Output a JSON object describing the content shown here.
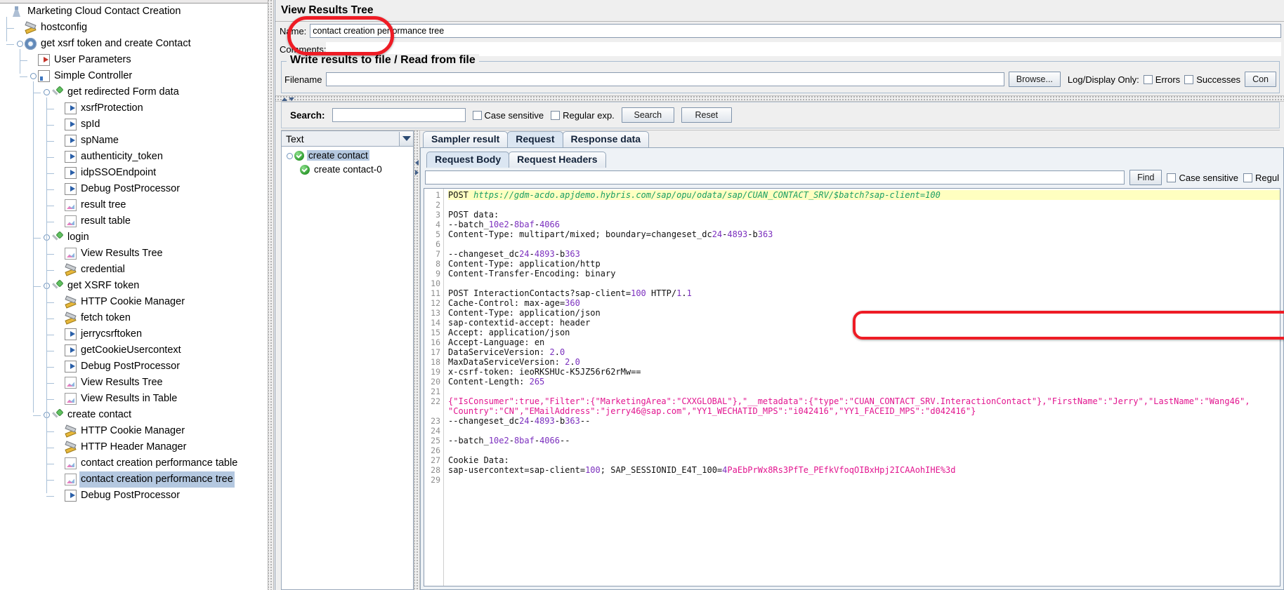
{
  "test_plan": {
    "nodes": [
      {
        "label": "Marketing Cloud Contact Creation",
        "depth": 0,
        "icon": "test-plan-icon",
        "handle": false
      },
      {
        "label": "hostconfig",
        "depth": 1,
        "icon": "config-tools-icon",
        "handle": false
      },
      {
        "label": "get xsrf token and create Contact",
        "depth": 1,
        "icon": "thread-group-gear-icon",
        "handle": true
      },
      {
        "label": "User Parameters",
        "depth": 2,
        "icon": "user-parameters-icon",
        "handle": false
      },
      {
        "label": "Simple Controller",
        "depth": 2,
        "icon": "simple-controller-icon",
        "handle": true
      },
      {
        "label": "get redirected Form data",
        "depth": 3,
        "icon": "http-sampler-icon",
        "handle": true
      },
      {
        "label": "xsrfProtection",
        "depth": 4,
        "icon": "post-processor-icon",
        "handle": false
      },
      {
        "label": "spId",
        "depth": 4,
        "icon": "post-processor-icon",
        "handle": false
      },
      {
        "label": "spName",
        "depth": 4,
        "icon": "post-processor-icon",
        "handle": false
      },
      {
        "label": "authenticity_token",
        "depth": 4,
        "icon": "post-processor-icon",
        "handle": false
      },
      {
        "label": "idpSSOEndpoint",
        "depth": 4,
        "icon": "post-processor-icon",
        "handle": false
      },
      {
        "label": "Debug PostProcessor",
        "depth": 4,
        "icon": "post-processor-icon",
        "handle": false
      },
      {
        "label": "result tree",
        "depth": 4,
        "icon": "listener-chart-icon",
        "handle": false
      },
      {
        "label": "result table",
        "depth": 4,
        "icon": "listener-chart-icon",
        "handle": false
      },
      {
        "label": "login",
        "depth": 3,
        "icon": "http-sampler-icon",
        "handle": true
      },
      {
        "label": "View Results Tree",
        "depth": 4,
        "icon": "listener-chart-icon",
        "handle": false
      },
      {
        "label": "credential",
        "depth": 4,
        "icon": "config-tools-icon",
        "handle": false
      },
      {
        "label": "get XSRF token",
        "depth": 3,
        "icon": "http-sampler-icon",
        "handle": true
      },
      {
        "label": "HTTP Cookie Manager",
        "depth": 4,
        "icon": "config-tools-icon",
        "handle": false
      },
      {
        "label": "fetch token",
        "depth": 4,
        "icon": "config-tools-icon",
        "handle": false
      },
      {
        "label": "jerrycsrftoken",
        "depth": 4,
        "icon": "post-processor-icon",
        "handle": false
      },
      {
        "label": "getCookieUsercontext",
        "depth": 4,
        "icon": "post-processor-icon",
        "handle": false
      },
      {
        "label": "Debug PostProcessor",
        "depth": 4,
        "icon": "post-processor-icon",
        "handle": false
      },
      {
        "label": "View Results Tree",
        "depth": 4,
        "icon": "listener-chart-icon",
        "handle": false
      },
      {
        "label": "View Results in Table",
        "depth": 4,
        "icon": "listener-chart-icon",
        "handle": false
      },
      {
        "label": "create contact",
        "depth": 3,
        "icon": "http-sampler-icon",
        "handle": true
      },
      {
        "label": "HTTP Cookie Manager",
        "depth": 4,
        "icon": "config-tools-icon",
        "handle": false
      },
      {
        "label": "HTTP Header Manager",
        "depth": 4,
        "icon": "config-tools-icon",
        "handle": false
      },
      {
        "label": "contact creation performance table",
        "depth": 4,
        "icon": "listener-chart-icon",
        "handle": false
      },
      {
        "label": "contact creation performance tree",
        "depth": 4,
        "icon": "listener-chart-icon",
        "handle": false,
        "selected": true
      },
      {
        "label": "Debug PostProcessor",
        "depth": 4,
        "icon": "post-processor-icon",
        "handle": false
      }
    ]
  },
  "panel": {
    "title": "View Results Tree",
    "name_label": "Name:",
    "name_value": "contact creation performance tree",
    "comments_label": "Comments:",
    "comments_value": "",
    "file_group_legend": "Write results to file / Read from file",
    "filename_label": "Filename",
    "filename_value": "",
    "browse_button": "Browse...",
    "log_display_label": "Log/Display Only:",
    "errors_checkbox": "Errors",
    "successes_checkbox": "Successes",
    "configure_button": "Con"
  },
  "search": {
    "label": "Search:",
    "value": "",
    "case_sensitive": "Case sensitive",
    "regular_exp": "Regular exp.",
    "search_button": "Search",
    "reset_button": "Reset"
  },
  "results_tree": {
    "combo_value": "Text",
    "nodes": [
      {
        "label": "create contact",
        "depth": 0,
        "selected": true
      },
      {
        "label": "create contact-0",
        "depth": 1,
        "selected": false
      }
    ]
  },
  "detail_tabs": {
    "tabs": [
      {
        "label": "Sampler result",
        "active": false
      },
      {
        "label": "Request",
        "active": true
      },
      {
        "label": "Response data",
        "active": false
      }
    ],
    "sub_tabs": [
      {
        "label": "Request Body",
        "active": true
      },
      {
        "label": "Request Headers",
        "active": false
      }
    ],
    "find_value": "",
    "find_button": "Find",
    "case_sensitive": "Case sensitive",
    "regular_exp": "Regul"
  },
  "request_body": {
    "lines": [
      {
        "n": 1,
        "text": "POST https://gdm-acdo.apjdemo.hybris.com/sap/opu/odata/sap/CUAN_CONTACT_SRV/$batch?sap-client=100",
        "style": "url",
        "highlight": true
      },
      {
        "n": 2,
        "text": "",
        "style": "plain"
      },
      {
        "n": 3,
        "text": "POST data:",
        "style": "plain"
      },
      {
        "n": 4,
        "text": "--batch_10e2-8baf-4066",
        "style": "num"
      },
      {
        "n": 5,
        "text": "Content-Type: multipart/mixed; boundary=changeset_dc24-4893-b363",
        "style": "num"
      },
      {
        "n": 6,
        "text": "",
        "style": "plain"
      },
      {
        "n": 7,
        "text": "--changeset_dc24-4893-b363",
        "style": "num"
      },
      {
        "n": 8,
        "text": "Content-Type: application/http",
        "style": "plain"
      },
      {
        "n": 9,
        "text": "Content-Transfer-Encoding: binary",
        "style": "plain"
      },
      {
        "n": 10,
        "text": "",
        "style": "plain"
      },
      {
        "n": 11,
        "text": "POST InteractionContacts?sap-client=100 HTTP/1.1",
        "style": "num"
      },
      {
        "n": 12,
        "text": "Cache-Control: max-age=360",
        "style": "num"
      },
      {
        "n": 13,
        "text": "Content-Type: application/json",
        "style": "plain"
      },
      {
        "n": 14,
        "text": "sap-contextid-accept: header",
        "style": "plain"
      },
      {
        "n": 15,
        "text": "Accept: application/json",
        "style": "plain"
      },
      {
        "n": 16,
        "text": "Accept-Language: en",
        "style": "plain"
      },
      {
        "n": 17,
        "text": "DataServiceVersion: 2.0",
        "style": "num"
      },
      {
        "n": 18,
        "text": "MaxDataServiceVersion: 2.0",
        "style": "num"
      },
      {
        "n": 19,
        "text": "x-csrf-token: ieoRKSHUc-K5JZ56r62rMw==",
        "style": "plain"
      },
      {
        "n": 20,
        "text": "Content-Length: 265",
        "style": "num"
      },
      {
        "n": 21,
        "text": "",
        "style": "plain"
      },
      {
        "n": 22,
        "text": "{\"IsConsumer\":true,\"Filter\":{\"MarketingArea\":\"CXXGLOBAL\"},\"__metadata\":{\"type\":\"CUAN_CONTACT_SRV.InteractionContact\"},\"FirstName\":\"Jerry\",\"LastName\":\"Wang46\",",
        "style": "json"
      },
      {
        "n": "",
        "text": "\"Country\":\"CN\",\"EMailAddress\":\"jerry46@sap.com\",\"YY1_WECHATID_MPS\":\"i042416\",\"YY1_FACEID_MPS\":\"d042416\"}",
        "style": "json"
      },
      {
        "n": 23,
        "text": "--changeset_dc24-4893-b363--",
        "style": "num"
      },
      {
        "n": 24,
        "text": "",
        "style": "plain"
      },
      {
        "n": 25,
        "text": "--batch_10e2-8baf-4066--",
        "style": "num"
      },
      {
        "n": 26,
        "text": "",
        "style": "plain"
      },
      {
        "n": 27,
        "text": "Cookie Data:",
        "style": "plain"
      },
      {
        "n": 28,
        "text": "sap-usercontext=sap-client=100; SAP_SESSIONID_E4T_100=4PaEbPrWx8Rs3PfTe_PEfkVfoqOIBxHpj2ICAAohIHE%3d",
        "style": "cookie"
      },
      {
        "n": 29,
        "text": "",
        "style": "plain"
      }
    ]
  },
  "colors": {
    "accent": "#b4c8e0",
    "annotation": "#ee1c25",
    "highlight": "#ffffc0",
    "url": "#1a9e64",
    "number": "#7b2fbe",
    "json": "#e2158f"
  }
}
